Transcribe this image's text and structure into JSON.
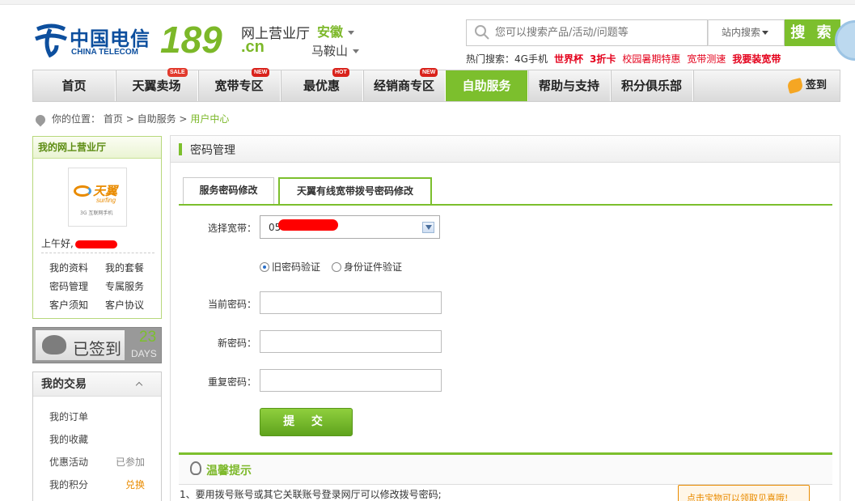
{
  "header": {
    "brand_cn": "中国电信",
    "brand_en": "CHINA TELECOM",
    "brand_number": "189",
    "brand_domain": ".cn",
    "hall_title": "网上营业厅",
    "province": "安徽",
    "city": "马鞍山",
    "search": {
      "placeholder": "您可以搜索产品/活动/问题等",
      "scope": "站内搜索",
      "button": "搜 索"
    },
    "hot_label": "热门搜索：",
    "hot_items": [
      "4G手机",
      "世界杯",
      "3折卡",
      "校园暑期特惠",
      "宽带测速",
      "我要装宽带"
    ]
  },
  "nav": {
    "items": [
      {
        "label": "首页"
      },
      {
        "label": "天翼卖场",
        "badge": "SALE"
      },
      {
        "label": "宽带专区",
        "badge": "NEW"
      },
      {
        "label": "最优惠",
        "badge": "HOT"
      },
      {
        "label": "经销商专区",
        "badge": "NEW"
      },
      {
        "label": "自助服务"
      },
      {
        "label": "帮助与支持"
      },
      {
        "label": "积分俱乐部"
      }
    ],
    "signin": "签到"
  },
  "breadcrumb": {
    "label": "你的位置：",
    "items": [
      "首页",
      "自助服务",
      "用户中心"
    ],
    "sep": ">"
  },
  "sidebar": {
    "my_title": "我的网上营业厅",
    "avatar_brand": "天翼",
    "avatar_sub": "surfing",
    "avatar_tag": "3G 互联网手机",
    "greeting": "上午好,",
    "links": [
      "我的资料",
      "我的套餐",
      "密码管理",
      "专属服务",
      "客户须知",
      "客户协议"
    ],
    "signed_label": "已签到",
    "signed_days": "23",
    "signed_unit": "DAYS",
    "trade_title": "我的交易",
    "trade_items": [
      {
        "label": "我的订单",
        "meta": ""
      },
      {
        "label": "我的收藏",
        "meta": ""
      },
      {
        "label": "优惠活动",
        "meta": "已参加"
      },
      {
        "label": "我的积分",
        "meta": "兑换"
      }
    ]
  },
  "main": {
    "title": "密码管理",
    "tabs": [
      "服务密码修改",
      "天翼有线宽带拨号密码修改"
    ],
    "form": {
      "broadband_label": "选择宽带：",
      "broadband_value": "05",
      "verify_options": [
        "旧密码验证",
        "身份证件验证"
      ],
      "current_label": "当前密码：",
      "new_label": "新密码：",
      "repeat_label": "重复密码：",
      "submit": "提 交"
    },
    "tips_title": "温馨提示",
    "tip_1": "1、要用拨号账号或其它关联账号登录网厅可以修改拨号密码;",
    "promo": "点击宝物可以领取见喜哦!"
  },
  "colors": {
    "brand_green": "#7cbf2d",
    "telecom_blue": "#0d4f9e",
    "hot_red": "#e4001b"
  }
}
